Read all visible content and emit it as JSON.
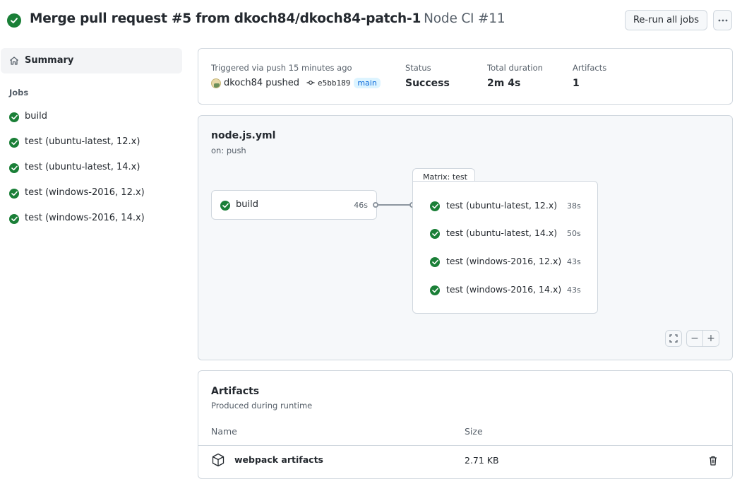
{
  "header": {
    "title": "Merge pull request #5 from dkoch84/dkoch84-patch-1",
    "workflow_run": "Node CI #11",
    "rerun_label": "Re-run all jobs",
    "more_label": "···"
  },
  "sidebar": {
    "summary_label": "Summary",
    "jobs_heading": "Jobs",
    "jobs": [
      {
        "label": "build"
      },
      {
        "label": "test (ubuntu-latest, 12.x)"
      },
      {
        "label": "test (ubuntu-latest, 14.x)"
      },
      {
        "label": "test (windows-2016, 12.x)"
      },
      {
        "label": "test (windows-2016, 14.x)"
      }
    ]
  },
  "summary": {
    "trigger_text": "Triggered via push 15 minutes ago",
    "user": "dkoch84",
    "verb": "pushed",
    "commit": "e5bb189",
    "branch": "main",
    "status_label": "Status",
    "status_value": "Success",
    "duration_label": "Total duration",
    "duration_value": "2m 4s",
    "artifacts_label": "Artifacts",
    "artifacts_value": "1"
  },
  "workflow": {
    "file": "node.js.yml",
    "trigger": "on: push",
    "build_job": {
      "name": "build",
      "duration": "46s"
    },
    "matrix_label": "Matrix: test",
    "matrix_jobs": [
      {
        "name": "test (ubuntu-latest, 12.x)",
        "duration": "38s"
      },
      {
        "name": "test (ubuntu-latest, 14.x)",
        "duration": "50s"
      },
      {
        "name": "test (windows-2016, 12.x)",
        "duration": "43s"
      },
      {
        "name": "test (windows-2016, 14.x)",
        "duration": "43s"
      }
    ],
    "zoom_out_label": "−",
    "zoom_in_label": "+"
  },
  "artifacts": {
    "title": "Artifacts",
    "subtitle": "Produced during runtime",
    "col_name": "Name",
    "col_size": "Size",
    "items": [
      {
        "name": "webpack artifacts",
        "size": "2.71 KB"
      }
    ]
  },
  "colors": {
    "success": "#1a7f37",
    "link": "#0969da",
    "border": "#d0d7de",
    "muted": "#57606a"
  }
}
